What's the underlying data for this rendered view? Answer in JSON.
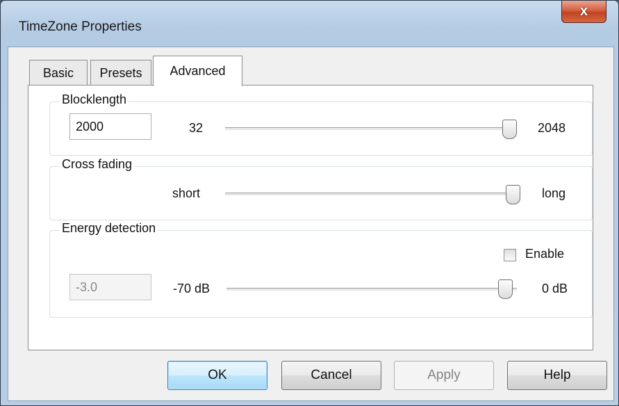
{
  "window": {
    "title": "TimeZone Properties",
    "close_glyph": "x"
  },
  "tabs": [
    {
      "label": "Basic",
      "active": false
    },
    {
      "label": "Presets",
      "active": false
    },
    {
      "label": "Advanced",
      "active": true
    }
  ],
  "blocklength": {
    "title": "Blocklength",
    "value": "2000",
    "min_label": "32",
    "max_label": "2048",
    "slider_fraction": 0.96
  },
  "crossfading": {
    "title": "Cross fading",
    "min_label": "short",
    "max_label": "long",
    "slider_fraction": 1.0
  },
  "energy": {
    "title": "Energy detection",
    "enable_label": "Enable",
    "enabled": false,
    "value": "-3.0",
    "min_label": "-70 dB",
    "max_label": "0 dB",
    "slider_fraction": 0.96
  },
  "buttons": {
    "ok": "OK",
    "cancel": "Cancel",
    "apply": "Apply",
    "help": "Help"
  }
}
